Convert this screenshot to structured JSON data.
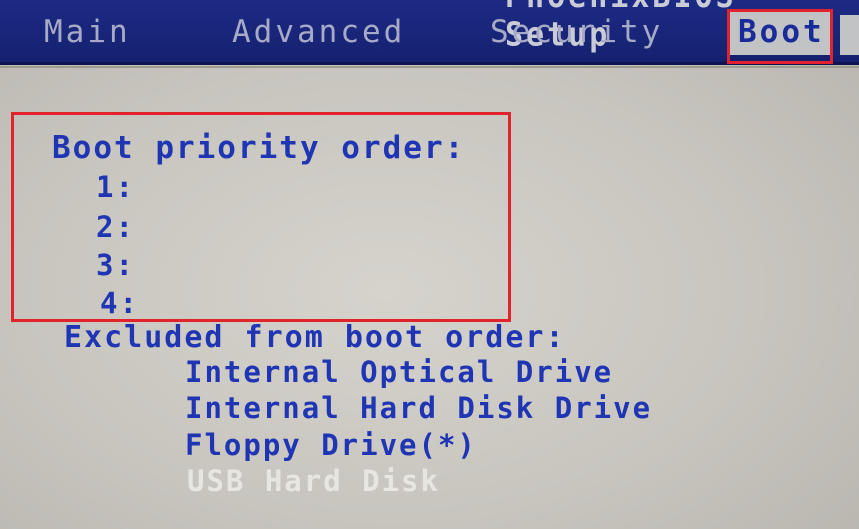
{
  "header": {
    "bios_title": "PhoenixBIOS Setup"
  },
  "tabs": [
    {
      "label": "Main"
    },
    {
      "label": "Advanced"
    },
    {
      "label": "Security"
    },
    {
      "label": "Boot",
      "selected": true
    }
  ],
  "boot_priority": {
    "title": "Boot priority order:",
    "slots": [
      "1:",
      "2:",
      "3:",
      "4:"
    ]
  },
  "excluded": {
    "title": "Excluded from boot order:",
    "devices": [
      "Internal Optical Drive",
      "Internal Hard Disk Drive",
      "Floppy Drive(*)",
      "USB Hard Disk"
    ]
  },
  "colors": {
    "menubar": "#1d2a85",
    "highlight_frame": "#e2232e",
    "text_blue": "#1f35b4",
    "selected_item_text": "#e8e6e1",
    "background": "#c8c5bf"
  }
}
